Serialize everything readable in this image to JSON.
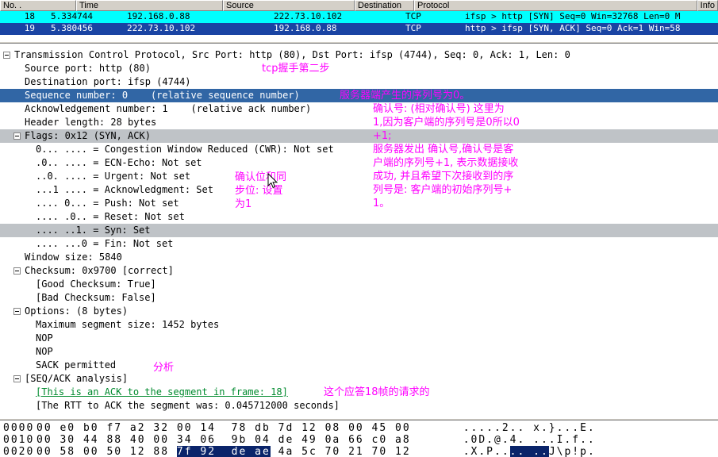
{
  "packet_list": {
    "columns": [
      "No. .",
      "Time",
      "Source",
      "Destination",
      "Protocol",
      "Info"
    ],
    "rows": [
      {
        "no": "18",
        "time": "5.334744",
        "source": "192.168.0.88",
        "destination": "222.73.10.102",
        "protocol": "TCP",
        "info": "ifsp > http [SYN] Seq=0 Win=32768 Len=0 M",
        "highlight": "cyan"
      },
      {
        "no": "19",
        "time": "5.380456",
        "source": "222.73.10.102",
        "destination": "192.168.0.88",
        "protocol": "TCP",
        "info": "http > ifsp [SYN, ACK] Seq=0 Ack=1 Win=58",
        "highlight": "selected"
      }
    ]
  },
  "detail_tree": {
    "lines": [
      {
        "indent": 0,
        "expander": true,
        "text": "Transmission Control Protocol, Src Port: http (80), Dst Port: ifsp (4744), Seq: 0, Ack: 1, Len: 0"
      },
      {
        "indent": 1,
        "text": "Source port: http (80)"
      },
      {
        "indent": 1,
        "text": "Destination port: ifsp (4744)"
      },
      {
        "indent": 1,
        "highlight": "sel",
        "text": "Sequence number: 0    (relative sequence number)"
      },
      {
        "indent": 1,
        "text": "Acknowledgement number: 1    (relative ack number)"
      },
      {
        "indent": 1,
        "text": "Header length: 28 bytes"
      },
      {
        "indent": 1,
        "expander": true,
        "highlight": "gray",
        "text": "Flags: 0x12 (SYN, ACK)"
      },
      {
        "indent": 2,
        "text": "0... .... = Congestion Window Reduced (CWR): Not set"
      },
      {
        "indent": 2,
        "text": ".0.. .... = ECN-Echo: Not set"
      },
      {
        "indent": 2,
        "text": "..0. .... = Urgent: Not set"
      },
      {
        "indent": 2,
        "text": "...1 .... = Acknowledgment: Set"
      },
      {
        "indent": 2,
        "text": ".... 0... = Push: Not set"
      },
      {
        "indent": 2,
        "text": ".... .0.. = Reset: Not set"
      },
      {
        "indent": 2,
        "highlight": "gray",
        "text": ".... ..1. = Syn: Set"
      },
      {
        "indent": 2,
        "text": ".... ...0 = Fin: Not set"
      },
      {
        "indent": 1,
        "text": "Window size: 5840"
      },
      {
        "indent": 1,
        "expander": true,
        "text": "Checksum: 0x9700 [correct]"
      },
      {
        "indent": 2,
        "text": "[Good Checksum: True]"
      },
      {
        "indent": 2,
        "text": "[Bad Checksum: False]"
      },
      {
        "indent": 1,
        "expander": true,
        "text": "Options: (8 bytes)"
      },
      {
        "indent": 2,
        "text": "Maximum segment size: 1452 bytes"
      },
      {
        "indent": 2,
        "text": "NOP"
      },
      {
        "indent": 2,
        "text": "NOP"
      },
      {
        "indent": 2,
        "text": "SACK permitted"
      },
      {
        "indent": 1,
        "expander": true,
        "text": "[SEQ/ACK analysis]"
      },
      {
        "indent": 2,
        "link": true,
        "text": "[This is an ACK to the segment in frame: 18]"
      },
      {
        "indent": 2,
        "text": "[The RTT to ACK the segment was: 0.045712000 seconds]"
      }
    ]
  },
  "annotations": {
    "handshake_step": "tcp握手第二步",
    "seq_note": "服务器端产生的序列号为0。",
    "ack_note_lines": [
      "确认号: (相对确认号) 这里为",
      "1,因为客户端的序列号是0所以0",
      "+1;",
      "服务器发出 确认号,确认号是客",
      "户端的序列号+1, 表示数据接收",
      "成功, 并且希望下次接收到的序",
      "列号是: 客户端的初始序列号+",
      "1。"
    ],
    "flag_note_lines": [
      "确认位和同",
      "步位: 设置",
      "为1"
    ],
    "analysis_label": "分析",
    "frame_ref_note": "这个应答18帧的请求的"
  },
  "hex_dump": {
    "rows": [
      {
        "offset": "0000",
        "hex": [
          {
            "t": "00 e0 b0 f7 a2 32 00 14  78 db 7d 12 08 00 45 00"
          }
        ],
        "ascii": [
          {
            "t": ".....2.. x.}...E."
          }
        ]
      },
      {
        "offset": "0010",
        "hex": [
          {
            "t": "00 30 44 88 40 00 34 06  9b 04 de 49 0a 66 c0 a8"
          }
        ],
        "ascii": [
          {
            "t": ".0D.@.4. ...I.f.."
          }
        ]
      },
      {
        "offset": "0020",
        "hex": [
          {
            "t": "00 58 00 50 12 88 "
          },
          {
            "t": "7f 92  de ae",
            "hl": true
          },
          {
            "t": " 4a 5c 70 21 70 12"
          }
        ],
        "ascii": [
          {
            "t": ".X.P.."
          },
          {
            "t": ".. ..",
            "hl": true
          },
          {
            "t": "J\\p!p."
          }
        ]
      }
    ]
  },
  "colors": {
    "row_cyan": "#00ffff",
    "row_selected": "#1a44a3",
    "detail_selected": "#3166a5",
    "band_gray": "#bfc3c7",
    "annotation_magenta": "#ff00ff",
    "link_green": "#008a2e",
    "hex_selected": "#0a246a"
  }
}
